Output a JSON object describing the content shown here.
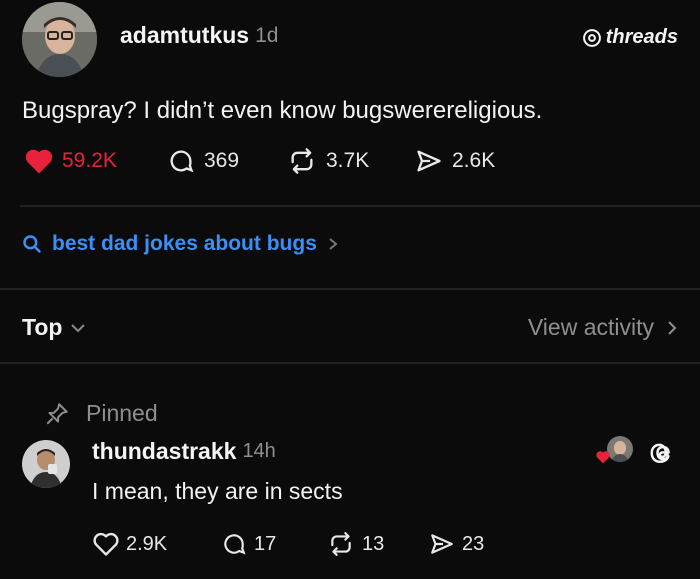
{
  "post": {
    "username": "adamtutkus",
    "time": "1d",
    "brand": "threads",
    "text": "Bugspray? I didn’t even know bugswerereligious.",
    "stats": {
      "likes": "59.2K",
      "replies": "369",
      "reposts": "3.7K",
      "shares": "2.6K"
    }
  },
  "search": {
    "query": "best dad jokes about bugs"
  },
  "sort": {
    "label": "Top",
    "view_activity": "View activity"
  },
  "comment": {
    "pinned_label": "Pinned",
    "username": "thundastrakk",
    "time": "14h",
    "text": "I mean, they are in sects",
    "stats": {
      "likes": "2.9K",
      "replies": "17",
      "reposts": "13",
      "shares": "23"
    }
  },
  "colors": {
    "like_red": "#e8223b",
    "link_blue": "#3b8ff5",
    "background": "#0b0b0b"
  },
  "icons": [
    "heart-icon",
    "comment-icon",
    "repost-icon",
    "share-icon",
    "search-icon",
    "chevron-right-icon",
    "chevron-down-icon",
    "pin-icon",
    "threads-logo-icon"
  ]
}
